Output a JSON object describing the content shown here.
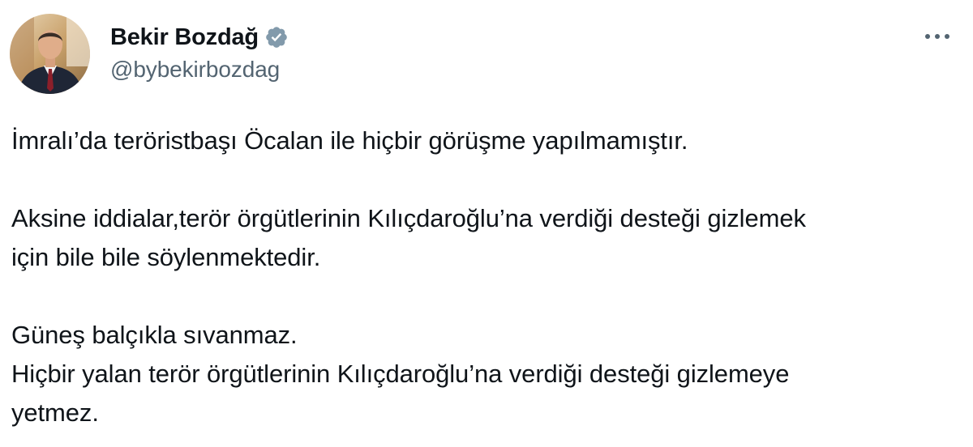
{
  "author": {
    "display_name": "Bekir Bozdağ",
    "handle": "@bybekirbozdag",
    "verified_icon": "verified-badge-icon",
    "avatar_icon": "profile-photo"
  },
  "actions": {
    "more_icon": "more-horizontal-icon"
  },
  "tweet": {
    "p1_line1": "İmralı’da teröristbaşı Öcalan ile hiçbir görüşme yapılmamıştır.",
    "p2_line1": "Aksine iddialar,terör örgütlerinin Kılıçdaroğlu’na verdiği desteği gizlemek",
    "p2_line2": "için bile bile söylenmektedir.",
    "p3_line1": "Güneş balçıkla sıvanmaz.",
    "p3_line2": "Hiçbir yalan terör örgütlerinin Kılıçdaroğlu’na verdiği desteği gizlemeye",
    "p3_line3": "yetmez."
  },
  "colors": {
    "text_primary": "#0f1419",
    "text_secondary": "#536471",
    "verified_badge": "#829aab"
  }
}
